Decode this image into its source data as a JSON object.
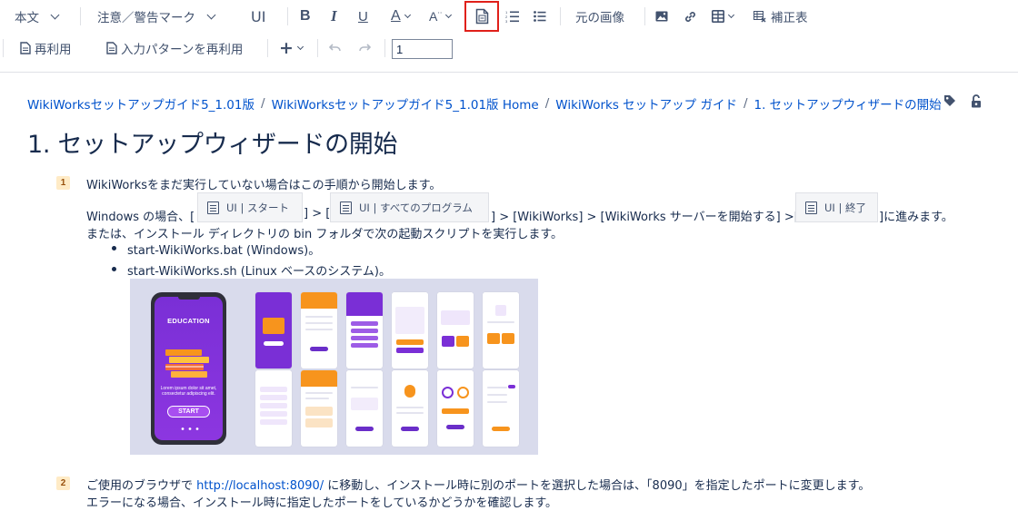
{
  "toolbar": {
    "paragraph_style": "本文",
    "macro": "注意／警告マーク",
    "ui_label": "UI",
    "bold": "B",
    "italic": "I",
    "underline": "U",
    "text_color": "A",
    "text_style": "A",
    "original_image": "元の画像",
    "correction_table": "補正表",
    "reuse": "再利用",
    "reuse_input_pattern": "入力パターンを再利用",
    "insert": "+",
    "page_value": "1",
    "highlight_color": "#e0201a"
  },
  "breadcrumb": {
    "items": [
      "WikiWorksセットアップガイド5_1.01版",
      "WikiWorksセットアップガイド5_1.01版 Home",
      "WikiWorks セットアップ ガイド",
      "1. セットアップウィザードの開始"
    ],
    "separator": "/"
  },
  "page": {
    "title": "1. セットアップウィザードの開始"
  },
  "steps": {
    "step1": {
      "number": "1",
      "line1": "WikiWorksをまだ実行していない場合はこの手順から開始します。",
      "windows_prefix": "Windows の場合、[",
      "bracket_mid1": "] > [",
      "mid_text": "] > [WikiWorks] > [WikiWorks サーバーを開始する] >[",
      "suffix": "]に進みます。",
      "ui_start": "UI | スタート",
      "ui_all_programs": "UI | すべてのプログラム",
      "ui_exit": "UI | 終了",
      "line3": "または、インストール ディレクトリの bin フォルダで次の起動スクリプトを実行します。",
      "bullets": [
        "start-WikiWorks.bat (Windows)。",
        "start-WikiWorks.sh (Linux ベースのシステム)。"
      ]
    },
    "step2": {
      "number": "2",
      "line1_before": "ご使用のブラウザで ",
      "url": "http://localhost:8090/",
      "line1_after": " に移動し、インストール時に別のポートを選択した場合は、「8090」を指定したポートに変更します。",
      "line2": "エラーになる場合、インストール時に指定したポートをしているかどうかを確認します。"
    }
  },
  "illustration": {
    "phone_title": "EDUCATION",
    "phone_text": "Lorem ipsum dolor sit amet, consectetur adipiscing elit.",
    "phone_button": "START",
    "accent_purple": "#7a2fd6",
    "accent_orange": "#f7941d"
  }
}
